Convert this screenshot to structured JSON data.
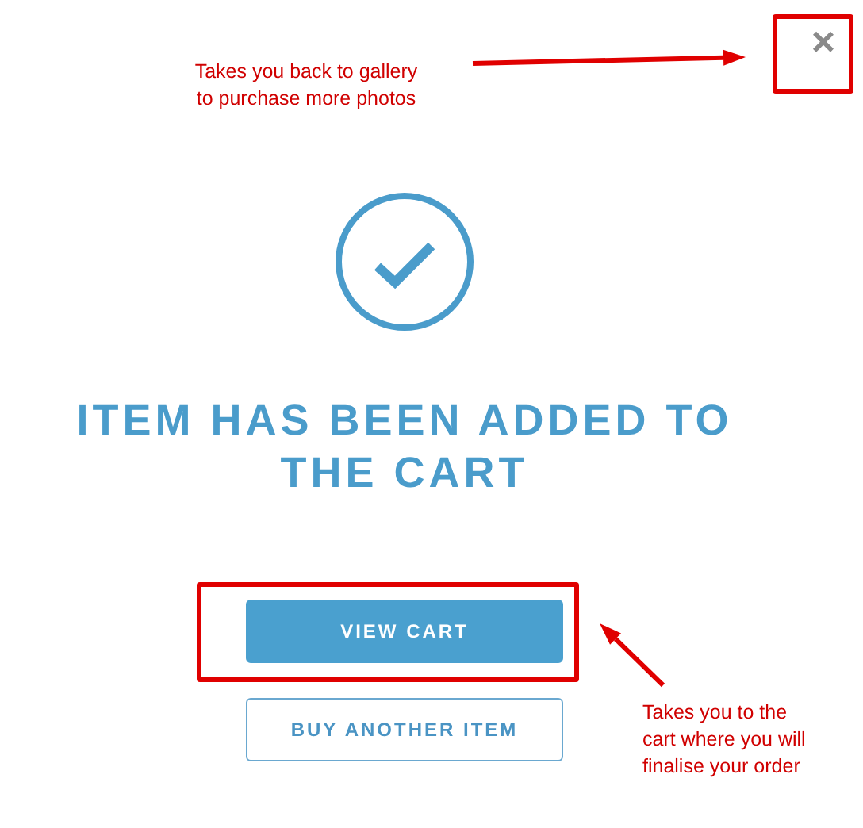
{
  "modal": {
    "close_label": "×",
    "title": "ITEM HAS BEEN ADDED TO THE CART",
    "buttons": [
      {
        "label": "VIEW CART",
        "kind": "primary"
      },
      {
        "label": "BUY ANOTHER ITEM",
        "kind": "secondary"
      }
    ]
  },
  "annotations": [
    {
      "text": "Takes you back to gallery\nto purchase more photos",
      "kind": "close"
    },
    {
      "text": "Takes you to the\ncart where you will\nfinalise your order",
      "kind": "primary"
    }
  ]
}
